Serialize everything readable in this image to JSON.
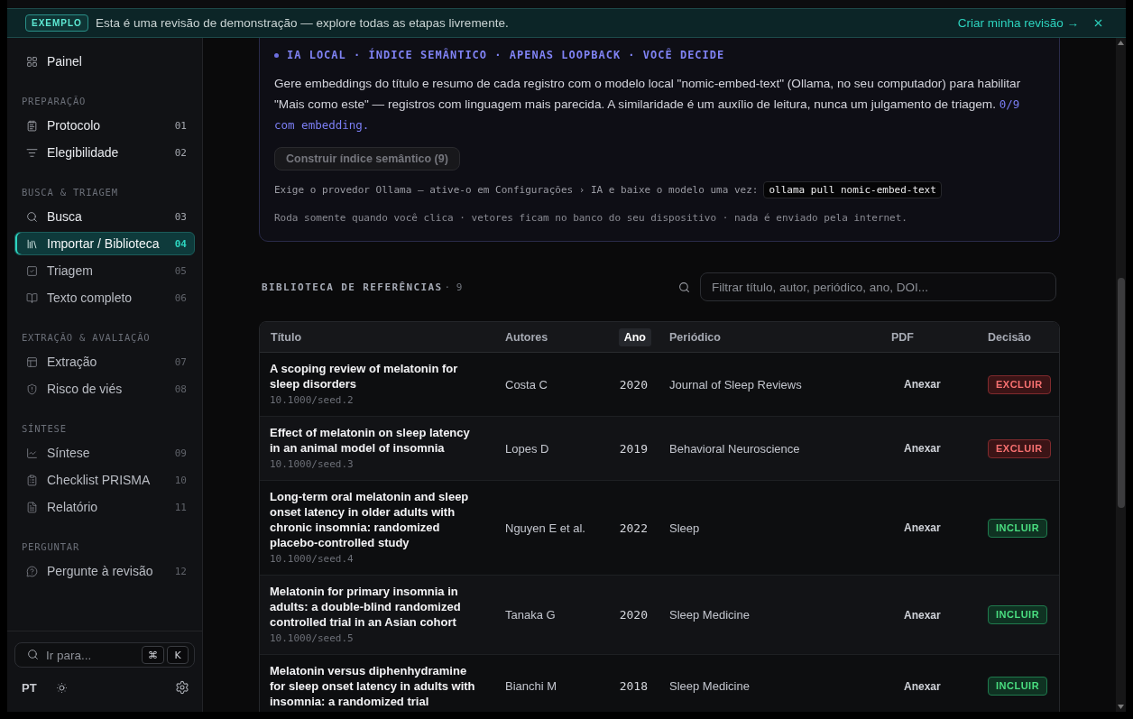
{
  "banner": {
    "badge": "EXEMPLO",
    "message": "Esta é uma revisão de demonstração — explore todas as etapas livremente.",
    "action": "Criar minha revisão →"
  },
  "sidebar": {
    "home": {
      "label": "Painel",
      "selected": false
    },
    "sections": [
      {
        "title": "PREPARAÇÃO",
        "items": [
          {
            "label": "Protocolo",
            "number": "01",
            "selected": false,
            "done": true
          },
          {
            "label": "Elegibilidade",
            "number": "02",
            "selected": false,
            "done": true
          }
        ]
      },
      {
        "title": "BUSCA & TRIAGEM",
        "items": [
          {
            "label": "Busca",
            "number": "03",
            "selected": false,
            "done": true
          },
          {
            "label": "Importar / Biblioteca",
            "number": "04",
            "selected": true,
            "done": false
          },
          {
            "label": "Triagem",
            "number": "05",
            "selected": false,
            "done": false
          },
          {
            "label": "Texto completo",
            "number": "06",
            "selected": false,
            "done": false
          }
        ]
      },
      {
        "title": "EXTRAÇÃO & AVALIAÇÃO",
        "items": [
          {
            "label": "Extração",
            "number": "07",
            "selected": false,
            "done": false
          },
          {
            "label": "Risco de viés",
            "number": "08",
            "selected": false,
            "done": false
          }
        ]
      },
      {
        "title": "SÍNTESE",
        "items": [
          {
            "label": "Síntese",
            "number": "09",
            "selected": false,
            "done": false
          },
          {
            "label": "Checklist PRISMA",
            "number": "10",
            "selected": false,
            "done": false
          },
          {
            "label": "Relatório",
            "number": "11",
            "selected": false,
            "done": false
          }
        ]
      },
      {
        "title": "PERGUNTAR",
        "items": [
          {
            "label": "Pergunte à revisão",
            "number": "12",
            "selected": false,
            "done": false
          }
        ]
      }
    ],
    "jump": {
      "placeholder": "Ir para...",
      "keys": [
        "⌘",
        "K"
      ]
    },
    "language": "PT"
  },
  "semantic_index": {
    "eyebrow": "IA LOCAL · ÍNDICE SEMÂNTICO · APENAS LOOPBACK · VOCÊ DECIDE",
    "description": "Gere embeddings do título e resumo de cada registro com o modelo local \"nomic-embed-text\" (Ollama, no seu computador) para habilitar \"Mais como este\" — registros com linguagem mais parecida. A similaridade é um auxílio de leitura, nunca um julgamento de triagem.",
    "status": "0/9 com embedding.",
    "button": {
      "label": "Construir índice semântico (9)",
      "disabled": true
    },
    "requirement": "Exige o provedor Ollama — ative-o em Configurações › IA e baixe o modelo uma vez:",
    "command": "ollama pull nomic-embed-text",
    "note": "Roda somente quando você clica · vetores ficam no banco do seu dispositivo · nada é enviado pela internet."
  },
  "library": {
    "title": "BIBLIOTECA DE REFERÊNCIAS",
    "count": "· 9",
    "filter": {
      "placeholder": "Filtrar título, autor, periódico, ano, DOI..."
    },
    "columns": [
      {
        "label": "Título",
        "sorted": false
      },
      {
        "label": "Autores",
        "sorted": false
      },
      {
        "label": "Ano",
        "sorted": true
      },
      {
        "label": "Periódico",
        "sorted": false
      },
      {
        "label": "PDF",
        "sorted": false
      },
      {
        "label": "Decisão",
        "sorted": false
      }
    ],
    "rows": [
      {
        "title": "A scoping review of melatonin for sleep disorders",
        "doi": "10.1000/seed.2",
        "authors": "Costa C",
        "year": "2020",
        "journal": "Journal of Sleep Reviews",
        "pdf": "Anexar",
        "decision": {
          "label": "EXCLUIR",
          "kind": "exclude"
        }
      },
      {
        "title": "Effect of melatonin on sleep latency in an animal model of insomnia",
        "doi": "10.1000/seed.3",
        "authors": "Lopes D",
        "year": "2019",
        "journal": "Behavioral Neuroscience",
        "pdf": "Anexar",
        "decision": {
          "label": "EXCLUIR",
          "kind": "exclude"
        }
      },
      {
        "title": "Long-term oral melatonin and sleep onset latency in older adults with chronic insomnia: randomized placebo-controlled study",
        "doi": "10.1000/seed.4",
        "authors": "Nguyen E et al.",
        "year": "2022",
        "journal": "Sleep",
        "pdf": "Anexar",
        "decision": {
          "label": "INCLUIR",
          "kind": "include"
        }
      },
      {
        "title": "Melatonin for primary insomnia in adults: a double-blind randomized controlled trial in an Asian cohort",
        "doi": "10.1000/seed.5",
        "authors": "Tanaka G",
        "year": "2020",
        "journal": "Sleep Medicine",
        "pdf": "Anexar",
        "decision": {
          "label": "INCLUIR",
          "kind": "include"
        }
      },
      {
        "title": "Melatonin versus diphenhydramine for sleep onset latency in adults with insomnia: a randomized trial",
        "authors": "Bianchi M",
        "year": "2018",
        "journal": "Sleep Medicine",
        "pdf": "Anexar",
        "decision": {
          "label": "INCLUIR",
          "kind": "include"
        }
      }
    ]
  }
}
